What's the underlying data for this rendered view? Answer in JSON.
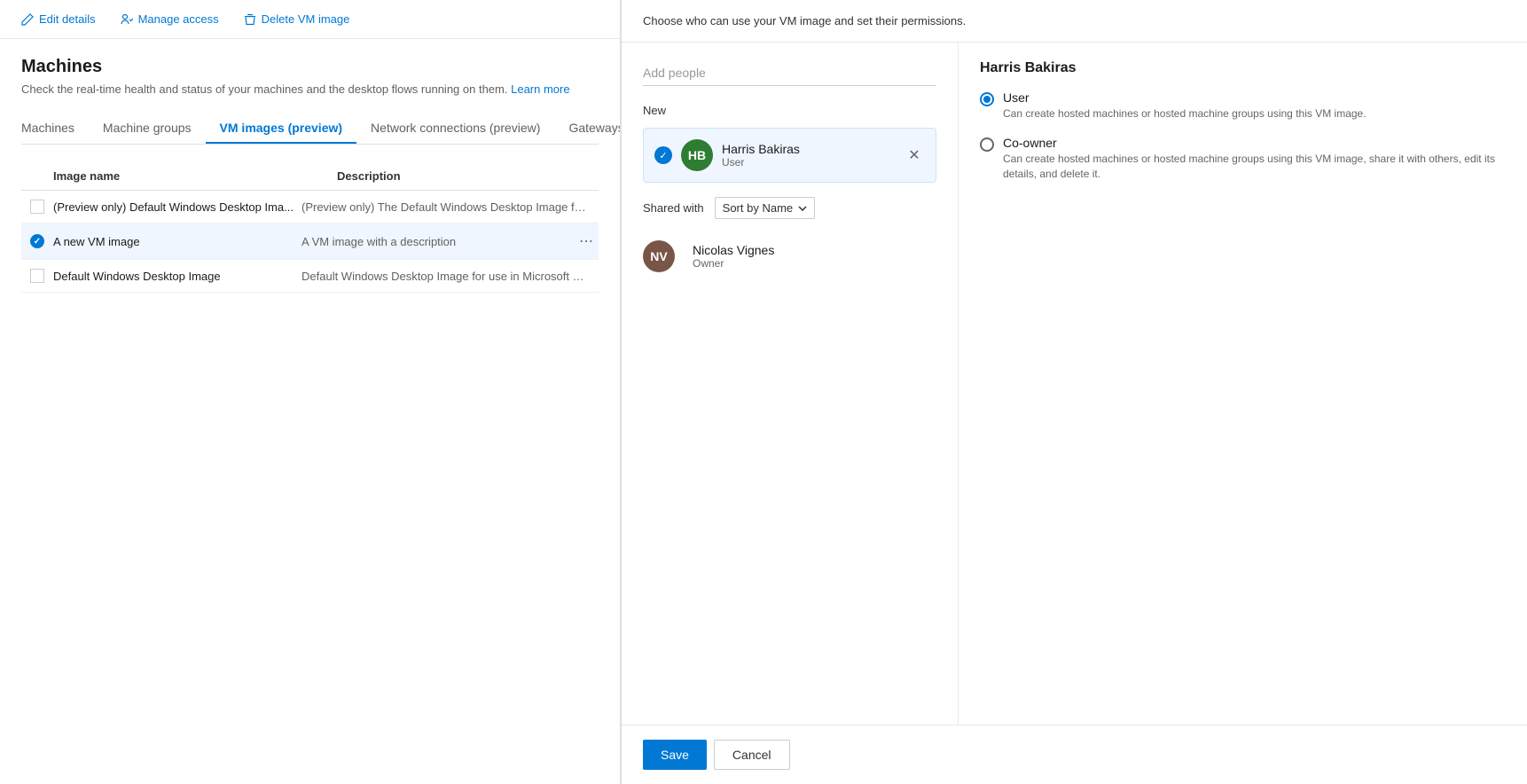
{
  "toolbar": {
    "edit_label": "Edit details",
    "manage_label": "Manage access",
    "delete_label": "Delete VM image"
  },
  "page": {
    "title": "Machines",
    "description": "Check the real-time health and status of your machines and the desktop flows running on them.",
    "learn_more": "Learn more"
  },
  "tabs": [
    {
      "id": "machines",
      "label": "Machines",
      "active": false
    },
    {
      "id": "machine-groups",
      "label": "Machine groups",
      "active": false
    },
    {
      "id": "vm-images",
      "label": "VM images (preview)",
      "active": true
    },
    {
      "id": "network-connections",
      "label": "Network connections (preview)",
      "active": false
    },
    {
      "id": "gateways",
      "label": "Gateways",
      "active": false
    }
  ],
  "table": {
    "col_name": "Image name",
    "col_desc": "Description",
    "rows": [
      {
        "name": "(Preview only) Default Windows Desktop Ima...",
        "desc": "(Preview only) The Default Windows Desktop Image for use i...",
        "selected": false,
        "has_menu": false
      },
      {
        "name": "A new VM image",
        "desc": "A VM image with a description",
        "selected": true,
        "has_menu": true
      },
      {
        "name": "Default Windows Desktop Image",
        "desc": "Default Windows Desktop Image for use in Microsoft Deskto...",
        "selected": false,
        "has_menu": false
      }
    ]
  },
  "right_panel": {
    "header_text": "Choose who can use your VM image and set their permissions.",
    "add_people_placeholder": "Add people",
    "new_label": "New",
    "shared_with_label": "Shared with",
    "sort_label": "Sort by Name",
    "selected_person": {
      "initials": "HB",
      "name": "Harris Bakiras",
      "role": "User"
    },
    "shared_people": [
      {
        "initials": "NV",
        "name": "Nicolas Vignes",
        "role": "Owner"
      }
    ],
    "permission_section": {
      "person_name": "Harris Bakiras",
      "options": [
        {
          "id": "user",
          "label": "User",
          "desc": "Can create hosted machines or hosted machine groups using this VM image.",
          "checked": true
        },
        {
          "id": "co-owner",
          "label": "Co-owner",
          "desc": "Can create hosted machines or hosted machine groups using this VM image, share it with others, edit its details, and delete it.",
          "checked": false
        }
      ]
    },
    "save_label": "Save",
    "cancel_label": "Cancel"
  }
}
